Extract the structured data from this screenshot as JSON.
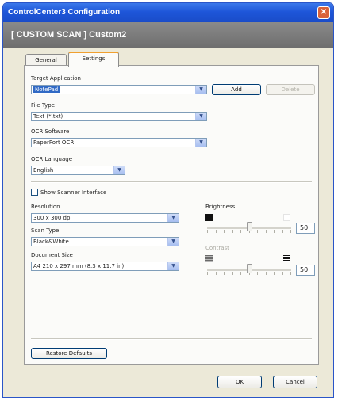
{
  "window": {
    "title": "ControlCenter3 Configuration",
    "close_glyph": "✕"
  },
  "header": {
    "title": "[ CUSTOM SCAN ]  Custom2"
  },
  "tabs": [
    {
      "label": "General",
      "active": false
    },
    {
      "label": "Settings",
      "active": true
    }
  ],
  "target_application": {
    "label": "Target Application",
    "value": "NotePad",
    "add_label": "Add",
    "delete_label": "Delete"
  },
  "file_type": {
    "label": "File Type",
    "value": "Text (*.txt)"
  },
  "ocr_software": {
    "label": "OCR Software",
    "value": "PaperPort OCR"
  },
  "ocr_language": {
    "label": "OCR Language",
    "value": "English"
  },
  "show_scanner_interface": {
    "label": "Show Scanner Interface",
    "checked": false
  },
  "resolution": {
    "label": "Resolution",
    "value": "300 x 300 dpi"
  },
  "scan_type": {
    "label": "Scan Type",
    "value": "Black&White"
  },
  "document_size": {
    "label": "Document Size",
    "value": "A4 210 x 297 mm (8.3 x 11.7 in)"
  },
  "brightness": {
    "label": "Brightness",
    "value": "50",
    "level": 0.5
  },
  "contrast": {
    "label": "Contrast",
    "value": "50",
    "level": 0.5,
    "enabled": false
  },
  "restore_defaults_label": "Restore Defaults",
  "ok_label": "OK",
  "cancel_label": "Cancel",
  "colors": {
    "title_bar": "#1e56d9",
    "close_button": "#d9623b",
    "selection": "#316ac5",
    "active_tab_accent": "#f0a030"
  }
}
